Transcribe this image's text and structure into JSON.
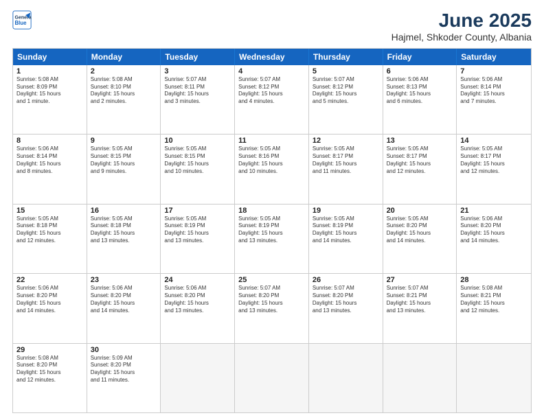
{
  "header": {
    "logo_line1": "General",
    "logo_line2": "Blue",
    "month": "June 2025",
    "location": "Hajmel, Shkoder County, Albania"
  },
  "days_of_week": [
    "Sunday",
    "Monday",
    "Tuesday",
    "Wednesday",
    "Thursday",
    "Friday",
    "Saturday"
  ],
  "rows": [
    [
      {
        "day": "1",
        "lines": [
          "Sunrise: 5:08 AM",
          "Sunset: 8:09 PM",
          "Daylight: 15 hours",
          "and 1 minute."
        ]
      },
      {
        "day": "2",
        "lines": [
          "Sunrise: 5:08 AM",
          "Sunset: 8:10 PM",
          "Daylight: 15 hours",
          "and 2 minutes."
        ]
      },
      {
        "day": "3",
        "lines": [
          "Sunrise: 5:07 AM",
          "Sunset: 8:11 PM",
          "Daylight: 15 hours",
          "and 3 minutes."
        ]
      },
      {
        "day": "4",
        "lines": [
          "Sunrise: 5:07 AM",
          "Sunset: 8:12 PM",
          "Daylight: 15 hours",
          "and 4 minutes."
        ]
      },
      {
        "day": "5",
        "lines": [
          "Sunrise: 5:07 AM",
          "Sunset: 8:12 PM",
          "Daylight: 15 hours",
          "and 5 minutes."
        ]
      },
      {
        "day": "6",
        "lines": [
          "Sunrise: 5:06 AM",
          "Sunset: 8:13 PM",
          "Daylight: 15 hours",
          "and 6 minutes."
        ]
      },
      {
        "day": "7",
        "lines": [
          "Sunrise: 5:06 AM",
          "Sunset: 8:14 PM",
          "Daylight: 15 hours",
          "and 7 minutes."
        ]
      }
    ],
    [
      {
        "day": "8",
        "lines": [
          "Sunrise: 5:06 AM",
          "Sunset: 8:14 PM",
          "Daylight: 15 hours",
          "and 8 minutes."
        ]
      },
      {
        "day": "9",
        "lines": [
          "Sunrise: 5:05 AM",
          "Sunset: 8:15 PM",
          "Daylight: 15 hours",
          "and 9 minutes."
        ]
      },
      {
        "day": "10",
        "lines": [
          "Sunrise: 5:05 AM",
          "Sunset: 8:15 PM",
          "Daylight: 15 hours",
          "and 10 minutes."
        ]
      },
      {
        "day": "11",
        "lines": [
          "Sunrise: 5:05 AM",
          "Sunset: 8:16 PM",
          "Daylight: 15 hours",
          "and 10 minutes."
        ]
      },
      {
        "day": "12",
        "lines": [
          "Sunrise: 5:05 AM",
          "Sunset: 8:17 PM",
          "Daylight: 15 hours",
          "and 11 minutes."
        ]
      },
      {
        "day": "13",
        "lines": [
          "Sunrise: 5:05 AM",
          "Sunset: 8:17 PM",
          "Daylight: 15 hours",
          "and 12 minutes."
        ]
      },
      {
        "day": "14",
        "lines": [
          "Sunrise: 5:05 AM",
          "Sunset: 8:17 PM",
          "Daylight: 15 hours",
          "and 12 minutes."
        ]
      }
    ],
    [
      {
        "day": "15",
        "lines": [
          "Sunrise: 5:05 AM",
          "Sunset: 8:18 PM",
          "Daylight: 15 hours",
          "and 12 minutes."
        ]
      },
      {
        "day": "16",
        "lines": [
          "Sunrise: 5:05 AM",
          "Sunset: 8:18 PM",
          "Daylight: 15 hours",
          "and 13 minutes."
        ]
      },
      {
        "day": "17",
        "lines": [
          "Sunrise: 5:05 AM",
          "Sunset: 8:19 PM",
          "Daylight: 15 hours",
          "and 13 minutes."
        ]
      },
      {
        "day": "18",
        "lines": [
          "Sunrise: 5:05 AM",
          "Sunset: 8:19 PM",
          "Daylight: 15 hours",
          "and 13 minutes."
        ]
      },
      {
        "day": "19",
        "lines": [
          "Sunrise: 5:05 AM",
          "Sunset: 8:19 PM",
          "Daylight: 15 hours",
          "and 14 minutes."
        ]
      },
      {
        "day": "20",
        "lines": [
          "Sunrise: 5:05 AM",
          "Sunset: 8:20 PM",
          "Daylight: 15 hours",
          "and 14 minutes."
        ]
      },
      {
        "day": "21",
        "lines": [
          "Sunrise: 5:06 AM",
          "Sunset: 8:20 PM",
          "Daylight: 15 hours",
          "and 14 minutes."
        ]
      }
    ],
    [
      {
        "day": "22",
        "lines": [
          "Sunrise: 5:06 AM",
          "Sunset: 8:20 PM",
          "Daylight: 15 hours",
          "and 14 minutes."
        ]
      },
      {
        "day": "23",
        "lines": [
          "Sunrise: 5:06 AM",
          "Sunset: 8:20 PM",
          "Daylight: 15 hours",
          "and 14 minutes."
        ]
      },
      {
        "day": "24",
        "lines": [
          "Sunrise: 5:06 AM",
          "Sunset: 8:20 PM",
          "Daylight: 15 hours",
          "and 13 minutes."
        ]
      },
      {
        "day": "25",
        "lines": [
          "Sunrise: 5:07 AM",
          "Sunset: 8:20 PM",
          "Daylight: 15 hours",
          "and 13 minutes."
        ]
      },
      {
        "day": "26",
        "lines": [
          "Sunrise: 5:07 AM",
          "Sunset: 8:20 PM",
          "Daylight: 15 hours",
          "and 13 minutes."
        ]
      },
      {
        "day": "27",
        "lines": [
          "Sunrise: 5:07 AM",
          "Sunset: 8:21 PM",
          "Daylight: 15 hours",
          "and 13 minutes."
        ]
      },
      {
        "day": "28",
        "lines": [
          "Sunrise: 5:08 AM",
          "Sunset: 8:21 PM",
          "Daylight: 15 hours",
          "and 12 minutes."
        ]
      }
    ],
    [
      {
        "day": "29",
        "lines": [
          "Sunrise: 5:08 AM",
          "Sunset: 8:20 PM",
          "Daylight: 15 hours",
          "and 12 minutes."
        ]
      },
      {
        "day": "30",
        "lines": [
          "Sunrise: 5:09 AM",
          "Sunset: 8:20 PM",
          "Daylight: 15 hours",
          "and 11 minutes."
        ]
      },
      {
        "day": "",
        "lines": []
      },
      {
        "day": "",
        "lines": []
      },
      {
        "day": "",
        "lines": []
      },
      {
        "day": "",
        "lines": []
      },
      {
        "day": "",
        "lines": []
      }
    ]
  ]
}
